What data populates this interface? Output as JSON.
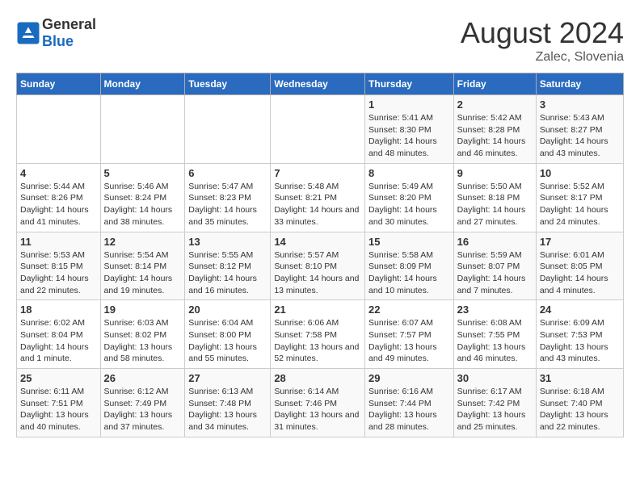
{
  "header": {
    "logo_general": "General",
    "logo_blue": "Blue",
    "main_title": "August 2024",
    "subtitle": "Zalec, Slovenia"
  },
  "days_of_week": [
    "Sunday",
    "Monday",
    "Tuesday",
    "Wednesday",
    "Thursday",
    "Friday",
    "Saturday"
  ],
  "weeks": [
    [
      {
        "day": "",
        "sunrise": "",
        "sunset": "",
        "daylight": ""
      },
      {
        "day": "",
        "sunrise": "",
        "sunset": "",
        "daylight": ""
      },
      {
        "day": "",
        "sunrise": "",
        "sunset": "",
        "daylight": ""
      },
      {
        "day": "",
        "sunrise": "",
        "sunset": "",
        "daylight": ""
      },
      {
        "day": "1",
        "sunrise": "Sunrise: 5:41 AM",
        "sunset": "Sunset: 8:30 PM",
        "daylight": "Daylight: 14 hours and 48 minutes."
      },
      {
        "day": "2",
        "sunrise": "Sunrise: 5:42 AM",
        "sunset": "Sunset: 8:28 PM",
        "daylight": "Daylight: 14 hours and 46 minutes."
      },
      {
        "day": "3",
        "sunrise": "Sunrise: 5:43 AM",
        "sunset": "Sunset: 8:27 PM",
        "daylight": "Daylight: 14 hours and 43 minutes."
      }
    ],
    [
      {
        "day": "4",
        "sunrise": "Sunrise: 5:44 AM",
        "sunset": "Sunset: 8:26 PM",
        "daylight": "Daylight: 14 hours and 41 minutes."
      },
      {
        "day": "5",
        "sunrise": "Sunrise: 5:46 AM",
        "sunset": "Sunset: 8:24 PM",
        "daylight": "Daylight: 14 hours and 38 minutes."
      },
      {
        "day": "6",
        "sunrise": "Sunrise: 5:47 AM",
        "sunset": "Sunset: 8:23 PM",
        "daylight": "Daylight: 14 hours and 35 minutes."
      },
      {
        "day": "7",
        "sunrise": "Sunrise: 5:48 AM",
        "sunset": "Sunset: 8:21 PM",
        "daylight": "Daylight: 14 hours and 33 minutes."
      },
      {
        "day": "8",
        "sunrise": "Sunrise: 5:49 AM",
        "sunset": "Sunset: 8:20 PM",
        "daylight": "Daylight: 14 hours and 30 minutes."
      },
      {
        "day": "9",
        "sunrise": "Sunrise: 5:50 AM",
        "sunset": "Sunset: 8:18 PM",
        "daylight": "Daylight: 14 hours and 27 minutes."
      },
      {
        "day": "10",
        "sunrise": "Sunrise: 5:52 AM",
        "sunset": "Sunset: 8:17 PM",
        "daylight": "Daylight: 14 hours and 24 minutes."
      }
    ],
    [
      {
        "day": "11",
        "sunrise": "Sunrise: 5:53 AM",
        "sunset": "Sunset: 8:15 PM",
        "daylight": "Daylight: 14 hours and 22 minutes."
      },
      {
        "day": "12",
        "sunrise": "Sunrise: 5:54 AM",
        "sunset": "Sunset: 8:14 PM",
        "daylight": "Daylight: 14 hours and 19 minutes."
      },
      {
        "day": "13",
        "sunrise": "Sunrise: 5:55 AM",
        "sunset": "Sunset: 8:12 PM",
        "daylight": "Daylight: 14 hours and 16 minutes."
      },
      {
        "day": "14",
        "sunrise": "Sunrise: 5:57 AM",
        "sunset": "Sunset: 8:10 PM",
        "daylight": "Daylight: 14 hours and 13 minutes."
      },
      {
        "day": "15",
        "sunrise": "Sunrise: 5:58 AM",
        "sunset": "Sunset: 8:09 PM",
        "daylight": "Daylight: 14 hours and 10 minutes."
      },
      {
        "day": "16",
        "sunrise": "Sunrise: 5:59 AM",
        "sunset": "Sunset: 8:07 PM",
        "daylight": "Daylight: 14 hours and 7 minutes."
      },
      {
        "day": "17",
        "sunrise": "Sunrise: 6:01 AM",
        "sunset": "Sunset: 8:05 PM",
        "daylight": "Daylight: 14 hours and 4 minutes."
      }
    ],
    [
      {
        "day": "18",
        "sunrise": "Sunrise: 6:02 AM",
        "sunset": "Sunset: 8:04 PM",
        "daylight": "Daylight: 14 hours and 1 minute."
      },
      {
        "day": "19",
        "sunrise": "Sunrise: 6:03 AM",
        "sunset": "Sunset: 8:02 PM",
        "daylight": "Daylight: 13 hours and 58 minutes."
      },
      {
        "day": "20",
        "sunrise": "Sunrise: 6:04 AM",
        "sunset": "Sunset: 8:00 PM",
        "daylight": "Daylight: 13 hours and 55 minutes."
      },
      {
        "day": "21",
        "sunrise": "Sunrise: 6:06 AM",
        "sunset": "Sunset: 7:58 PM",
        "daylight": "Daylight: 13 hours and 52 minutes."
      },
      {
        "day": "22",
        "sunrise": "Sunrise: 6:07 AM",
        "sunset": "Sunset: 7:57 PM",
        "daylight": "Daylight: 13 hours and 49 minutes."
      },
      {
        "day": "23",
        "sunrise": "Sunrise: 6:08 AM",
        "sunset": "Sunset: 7:55 PM",
        "daylight": "Daylight: 13 hours and 46 minutes."
      },
      {
        "day": "24",
        "sunrise": "Sunrise: 6:09 AM",
        "sunset": "Sunset: 7:53 PM",
        "daylight": "Daylight: 13 hours and 43 minutes."
      }
    ],
    [
      {
        "day": "25",
        "sunrise": "Sunrise: 6:11 AM",
        "sunset": "Sunset: 7:51 PM",
        "daylight": "Daylight: 13 hours and 40 minutes."
      },
      {
        "day": "26",
        "sunrise": "Sunrise: 6:12 AM",
        "sunset": "Sunset: 7:49 PM",
        "daylight": "Daylight: 13 hours and 37 minutes."
      },
      {
        "day": "27",
        "sunrise": "Sunrise: 6:13 AM",
        "sunset": "Sunset: 7:48 PM",
        "daylight": "Daylight: 13 hours and 34 minutes."
      },
      {
        "day": "28",
        "sunrise": "Sunrise: 6:14 AM",
        "sunset": "Sunset: 7:46 PM",
        "daylight": "Daylight: 13 hours and 31 minutes."
      },
      {
        "day": "29",
        "sunrise": "Sunrise: 6:16 AM",
        "sunset": "Sunset: 7:44 PM",
        "daylight": "Daylight: 13 hours and 28 minutes."
      },
      {
        "day": "30",
        "sunrise": "Sunrise: 6:17 AM",
        "sunset": "Sunset: 7:42 PM",
        "daylight": "Daylight: 13 hours and 25 minutes."
      },
      {
        "day": "31",
        "sunrise": "Sunrise: 6:18 AM",
        "sunset": "Sunset: 7:40 PM",
        "daylight": "Daylight: 13 hours and 22 minutes."
      }
    ]
  ]
}
